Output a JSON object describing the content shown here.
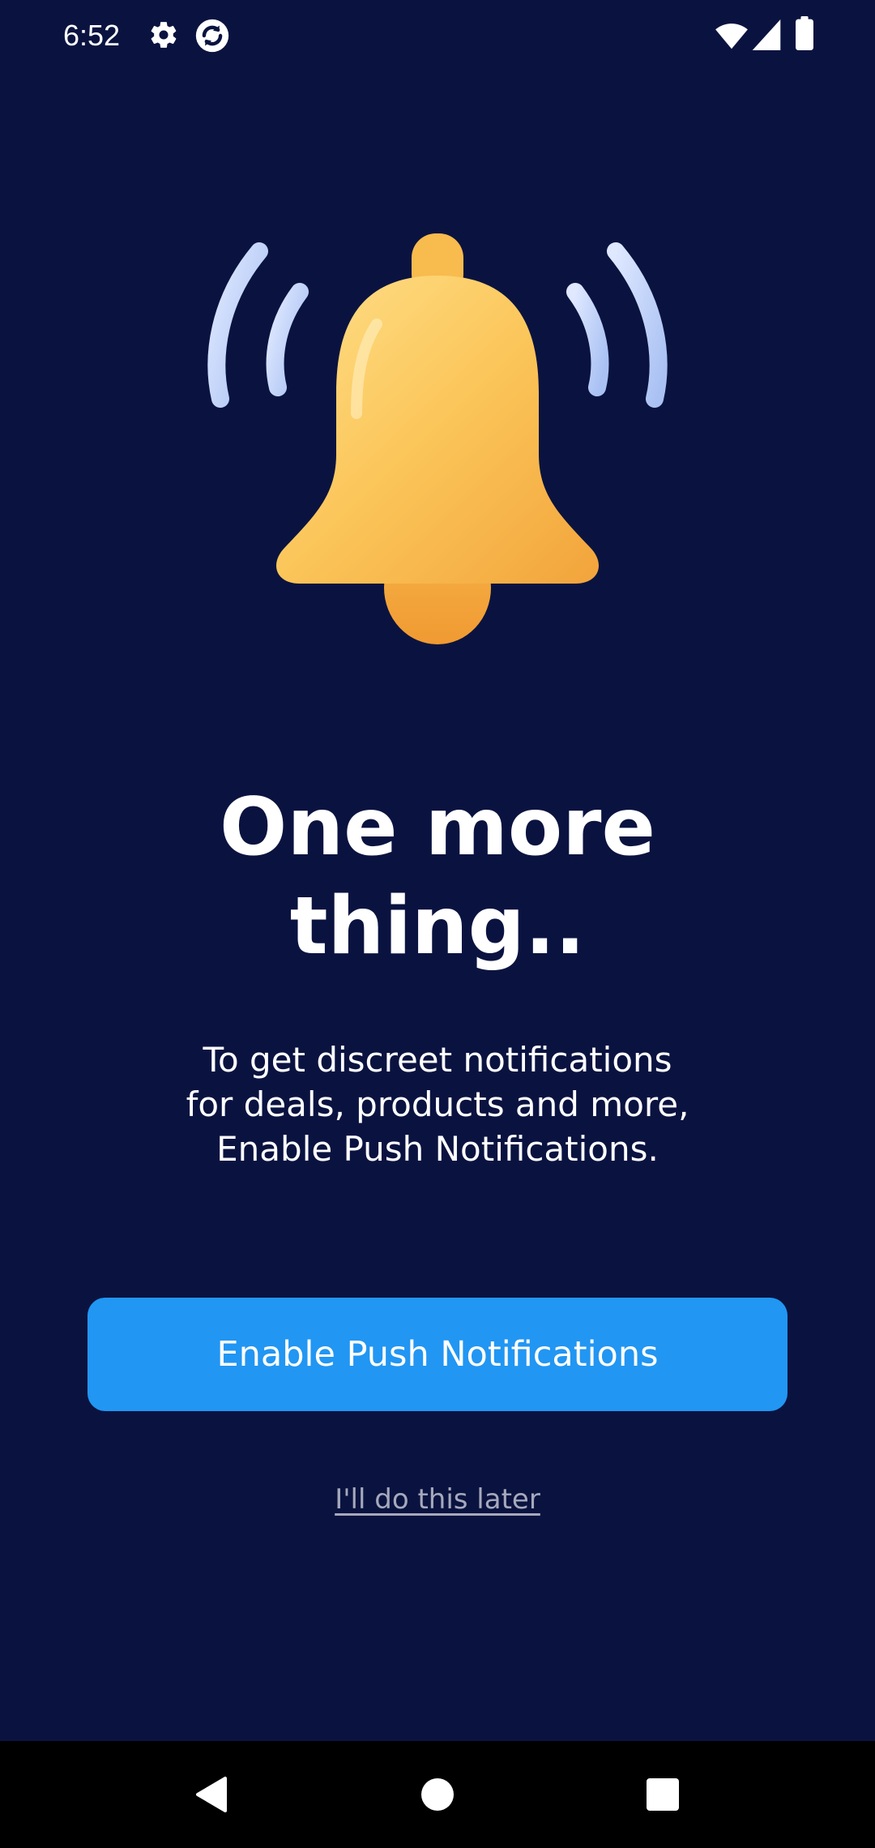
{
  "status_bar": {
    "time": "6:52",
    "left_icons": [
      "gear-icon",
      "sync-icon"
    ],
    "right_icons": [
      "wifi-icon",
      "cellular-signal-icon",
      "battery-icon"
    ]
  },
  "illustration": {
    "icon": "bell-ringing-icon",
    "bell_color": "#fbc559",
    "wave_color": "#b9cdf7"
  },
  "headline": {
    "line1": "One more",
    "line2": "thing.."
  },
  "description": {
    "line1": "To get discreet notifications",
    "line2": "for deals, products and more,",
    "line3": "Enable Push Notifications."
  },
  "primary_button": {
    "label": "Enable Push Notifications",
    "color": "#2196f3"
  },
  "secondary_link": {
    "label": "I'll do this later"
  },
  "nav_bar": {
    "buttons": [
      "back-icon",
      "home-icon",
      "recents-icon"
    ]
  },
  "colors": {
    "background": "#0a1340",
    "link": "#a6a9bb"
  }
}
